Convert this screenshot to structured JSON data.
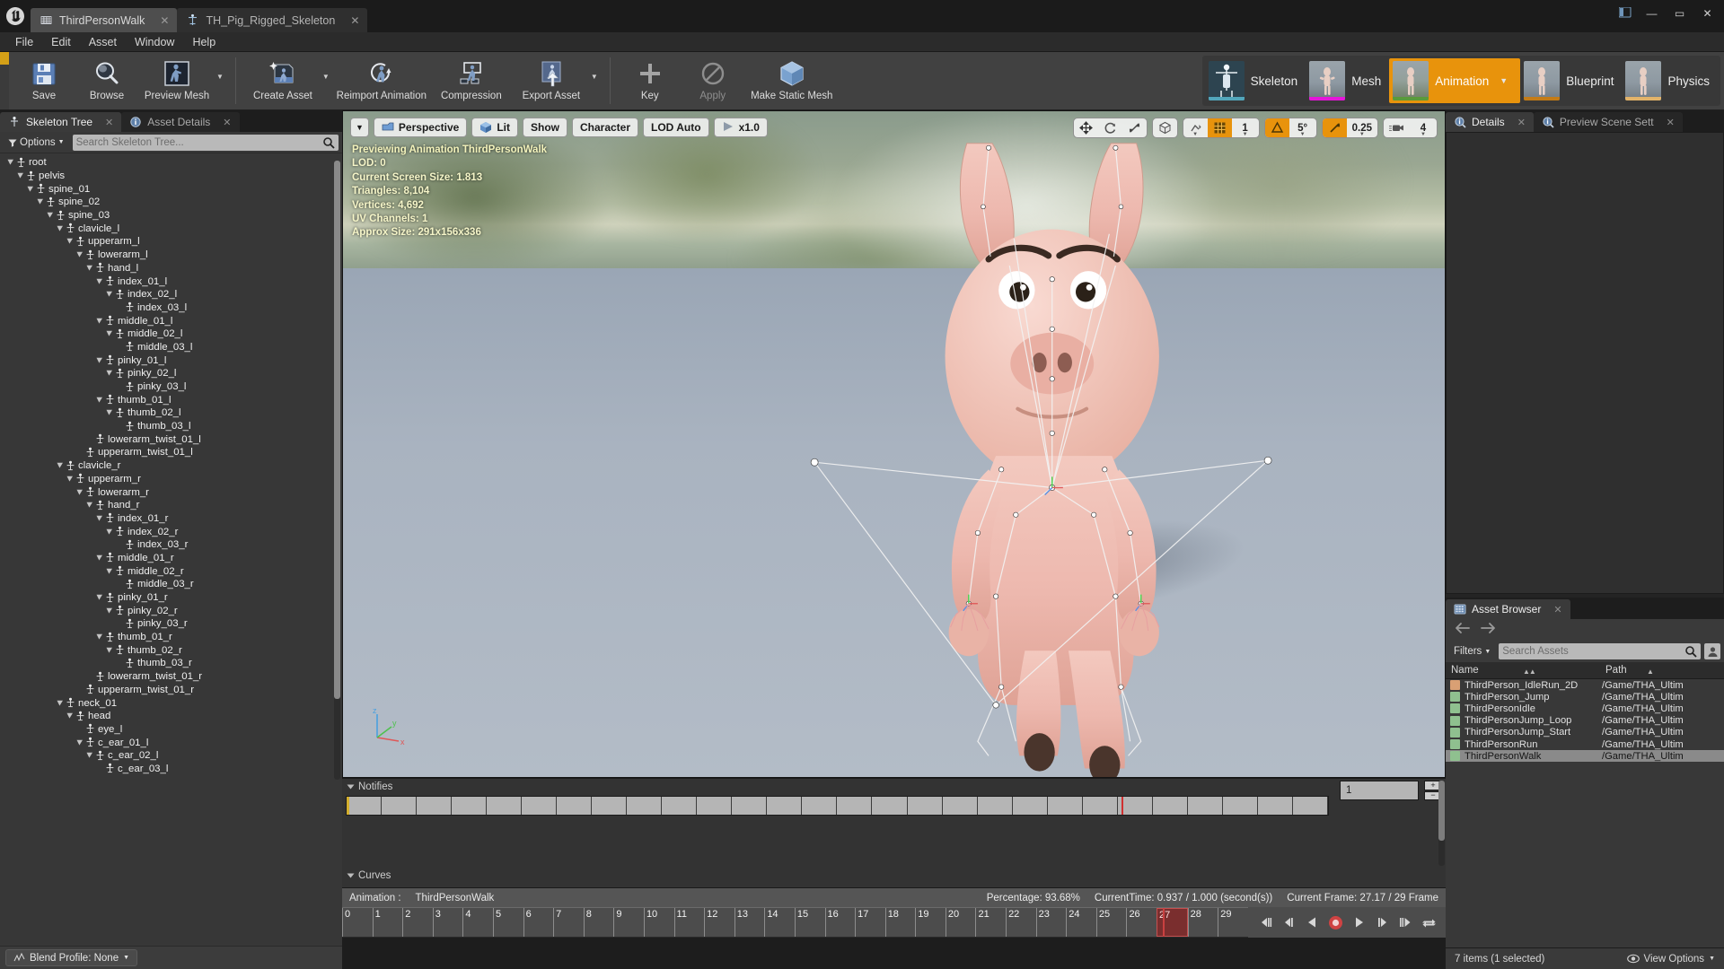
{
  "window": {
    "tabs": [
      {
        "label": "ThirdPersonWalk",
        "icon": "animation-sequence-icon",
        "active": true
      },
      {
        "label": "TH_Pig_Rigged_Skeleton",
        "icon": "skeleton-icon",
        "active": false
      }
    ],
    "controls": {
      "minimize": "—",
      "maximize": "▭",
      "close": "✕"
    }
  },
  "menubar": {
    "items": [
      "File",
      "Edit",
      "Asset",
      "Window",
      "Help"
    ]
  },
  "toolbar": {
    "items": [
      {
        "label": "Save",
        "icon": "save-icon",
        "dropdown": false
      },
      {
        "label": "Browse",
        "icon": "browse-icon",
        "dropdown": false
      },
      {
        "label": "Preview Mesh",
        "icon": "preview-mesh-icon",
        "dropdown": true
      },
      {
        "label": "Create Asset",
        "icon": "create-asset-icon",
        "dropdown": true
      },
      {
        "label": "Reimport Animation",
        "icon": "reimport-animation-icon",
        "dropdown": false
      },
      {
        "label": "Compression",
        "icon": "compression-icon",
        "dropdown": false
      },
      {
        "label": "Export Asset",
        "icon": "export-asset-icon",
        "dropdown": true
      },
      {
        "label": "Key",
        "icon": "key-icon",
        "dropdown": false
      },
      {
        "label": "Apply",
        "icon": "apply-icon",
        "dropdown": false,
        "disabled": true
      },
      {
        "label": "Make Static Mesh",
        "icon": "make-static-mesh-icon",
        "dropdown": false
      }
    ]
  },
  "modes": {
    "items": [
      {
        "label": "Skeleton",
        "accent": "#52a6bb",
        "active": false
      },
      {
        "label": "Mesh",
        "accent": "#e515d9",
        "active": false
      },
      {
        "label": "Animation",
        "accent": "#5a9b3a",
        "active": true,
        "dropdown": true
      },
      {
        "label": "Blueprint",
        "accent": "#c47b16",
        "active": false
      },
      {
        "label": "Physics",
        "accent": "#e2b36a",
        "active": false
      }
    ],
    "active_color": "#e8930c"
  },
  "left_panel": {
    "tabs": [
      {
        "label": "Skeleton Tree",
        "icon": "skeleton-tree-icon",
        "active": true
      },
      {
        "label": "Asset Details",
        "icon": "asset-details-icon",
        "active": false
      }
    ],
    "options_label": "Options",
    "search_placeholder": "Search Skeleton Tree...",
    "blend_profile_label": "Blend Profile: None",
    "tree": [
      {
        "name": "root",
        "depth": 0,
        "expanded": true
      },
      {
        "name": "pelvis",
        "depth": 1,
        "expanded": true
      },
      {
        "name": "spine_01",
        "depth": 2,
        "expanded": true
      },
      {
        "name": "spine_02",
        "depth": 3,
        "expanded": true
      },
      {
        "name": "spine_03",
        "depth": 4,
        "expanded": true
      },
      {
        "name": "clavicle_l",
        "depth": 5,
        "expanded": true
      },
      {
        "name": "upperarm_l",
        "depth": 6,
        "expanded": true
      },
      {
        "name": "lowerarm_l",
        "depth": 7,
        "expanded": true
      },
      {
        "name": "hand_l",
        "depth": 8,
        "expanded": true
      },
      {
        "name": "index_01_l",
        "depth": 9,
        "expanded": true
      },
      {
        "name": "index_02_l",
        "depth": 10,
        "expanded": true
      },
      {
        "name": "index_03_l",
        "depth": 11,
        "expanded": false
      },
      {
        "name": "middle_01_l",
        "depth": 9,
        "expanded": true
      },
      {
        "name": "middle_02_l",
        "depth": 10,
        "expanded": true
      },
      {
        "name": "middle_03_l",
        "depth": 11,
        "expanded": false
      },
      {
        "name": "pinky_01_l",
        "depth": 9,
        "expanded": true
      },
      {
        "name": "pinky_02_l",
        "depth": 10,
        "expanded": true
      },
      {
        "name": "pinky_03_l",
        "depth": 11,
        "expanded": false
      },
      {
        "name": "thumb_01_l",
        "depth": 9,
        "expanded": true
      },
      {
        "name": "thumb_02_l",
        "depth": 10,
        "expanded": true
      },
      {
        "name": "thumb_03_l",
        "depth": 11,
        "expanded": false
      },
      {
        "name": "lowerarm_twist_01_l",
        "depth": 8,
        "expanded": false
      },
      {
        "name": "upperarm_twist_01_l",
        "depth": 7,
        "expanded": false
      },
      {
        "name": "clavicle_r",
        "depth": 5,
        "expanded": true
      },
      {
        "name": "upperarm_r",
        "depth": 6,
        "expanded": true
      },
      {
        "name": "lowerarm_r",
        "depth": 7,
        "expanded": true
      },
      {
        "name": "hand_r",
        "depth": 8,
        "expanded": true
      },
      {
        "name": "index_01_r",
        "depth": 9,
        "expanded": true
      },
      {
        "name": "index_02_r",
        "depth": 10,
        "expanded": true
      },
      {
        "name": "index_03_r",
        "depth": 11,
        "expanded": false
      },
      {
        "name": "middle_01_r",
        "depth": 9,
        "expanded": true
      },
      {
        "name": "middle_02_r",
        "depth": 10,
        "expanded": true
      },
      {
        "name": "middle_03_r",
        "depth": 11,
        "expanded": false
      },
      {
        "name": "pinky_01_r",
        "depth": 9,
        "expanded": true
      },
      {
        "name": "pinky_02_r",
        "depth": 10,
        "expanded": true
      },
      {
        "name": "pinky_03_r",
        "depth": 11,
        "expanded": false
      },
      {
        "name": "thumb_01_r",
        "depth": 9,
        "expanded": true
      },
      {
        "name": "thumb_02_r",
        "depth": 10,
        "expanded": true
      },
      {
        "name": "thumb_03_r",
        "depth": 11,
        "expanded": false
      },
      {
        "name": "lowerarm_twist_01_r",
        "depth": 8,
        "expanded": false
      },
      {
        "name": "upperarm_twist_01_r",
        "depth": 7,
        "expanded": false
      },
      {
        "name": "neck_01",
        "depth": 5,
        "expanded": true
      },
      {
        "name": "head",
        "depth": 6,
        "expanded": true
      },
      {
        "name": "eye_l",
        "depth": 7,
        "expanded": false
      },
      {
        "name": "c_ear_01_l",
        "depth": 7,
        "expanded": true
      },
      {
        "name": "c_ear_02_l",
        "depth": 8,
        "expanded": true
      },
      {
        "name": "c_ear_03_l",
        "depth": 9,
        "expanded": false
      }
    ]
  },
  "viewport": {
    "toolbar": [
      {
        "label": "Perspective",
        "icon": "camera-icon"
      },
      {
        "label": "Lit",
        "icon": "lighting-cube-icon"
      },
      {
        "label": "Show",
        "icon": ""
      },
      {
        "label": "Character",
        "icon": ""
      },
      {
        "label": "LOD Auto",
        "icon": ""
      },
      {
        "label": "x1.0",
        "icon": "play-speed-icon"
      }
    ],
    "dropdown_caret": "▾",
    "stats": {
      "previewing": "Previewing Animation ThirdPersonWalk",
      "lod": "LOD: 0",
      "screen_size": "Current Screen Size: 1.813",
      "triangles": "Triangles: 8,104",
      "vertices": "Vertices: 4,692",
      "uv_channels": "UV Channels: 1",
      "approx_size": "Approx Size: 291x156x336"
    },
    "transform_tools": {
      "translate_icon": "move-tool-icon",
      "rotate_icon": "rotate-tool-icon",
      "scale_icon": "scale-tool-icon",
      "coord_icon": "world-space-icon",
      "surface_snap_icon": "surface-snap-icon",
      "grid_snap_icon": "grid-snap-icon",
      "grid_snap_value": "1",
      "angle_snap_icon": "angle-snap-icon",
      "angle_snap_value": "5°",
      "scale_snap_icon": "scale-snap-icon",
      "scale_snap_value": "0.25",
      "camera_speed_icon": "camera-speed-icon",
      "camera_speed_value": "4"
    },
    "axis": {
      "z": "z",
      "y": "y",
      "x": "x"
    }
  },
  "notifies": {
    "title": "Notifies",
    "curves_title": "Curves",
    "frame_value": "1",
    "plus": "+",
    "minus": "−",
    "track_cells": 28,
    "playhead_pct": 79
  },
  "timeline": {
    "animation_label": "Animation :",
    "animation_name": "ThirdPersonWalk",
    "percentage": "Percentage:  93.68%",
    "current_time": "CurrentTime:  0.937 / 1.000 (second(s))",
    "current_frame": "Current Frame:  27.17 / 29 Frame",
    "frames": [
      "0",
      "1",
      "2",
      "3",
      "4",
      "5",
      "6",
      "7",
      "8",
      "9",
      "10",
      "11",
      "12",
      "13",
      "14",
      "15",
      "16",
      "17",
      "18",
      "19",
      "20",
      "21",
      "22",
      "23",
      "24",
      "25",
      "26",
      "27",
      "28",
      "29"
    ],
    "current_frame_index": 27,
    "transport": [
      {
        "name": "skip-to-start-button",
        "glyph": "start"
      },
      {
        "name": "step-back-button",
        "glyph": "stepback"
      },
      {
        "name": "play-reverse-button",
        "glyph": "playrev"
      },
      {
        "name": "record-button",
        "glyph": "record"
      },
      {
        "name": "play-forward-button",
        "glyph": "play"
      },
      {
        "name": "step-forward-button",
        "glyph": "stepfwd"
      },
      {
        "name": "skip-to-end-button",
        "glyph": "end"
      },
      {
        "name": "loop-button",
        "glyph": "loop"
      }
    ]
  },
  "right_panel": {
    "tabs": [
      {
        "label": "Details",
        "icon": "details-icon",
        "active": true
      },
      {
        "label": "Preview Scene Sett",
        "icon": "preview-scene-icon",
        "active": false
      }
    ],
    "asset_browser": {
      "tab_label": "Asset Browser",
      "tab_icon": "asset-browser-icon",
      "back_icon": "arrow-left-icon",
      "forward_icon": "arrow-right-icon",
      "filters_label": "Filters",
      "search_placeholder": "Search Assets",
      "columns": [
        "Name",
        "Path"
      ],
      "rows": [
        {
          "name": "ThirdPerson_IdleRun_2D",
          "path": "/Game/THA_Ultim",
          "color": "#d9a074",
          "selected": false
        },
        {
          "name": "ThirdPerson_Jump",
          "path": "/Game/THA_Ultim",
          "color": "#8fc08f",
          "selected": false
        },
        {
          "name": "ThirdPersonIdle",
          "path": "/Game/THA_Ultim",
          "color": "#8fc08f",
          "selected": false
        },
        {
          "name": "ThirdPersonJump_Loop",
          "path": "/Game/THA_Ultim",
          "color": "#8fc08f",
          "selected": false
        },
        {
          "name": "ThirdPersonJump_Start",
          "path": "/Game/THA_Ultim",
          "color": "#8fc08f",
          "selected": false
        },
        {
          "name": "ThirdPersonRun",
          "path": "/Game/THA_Ultim",
          "color": "#8fc08f",
          "selected": false
        },
        {
          "name": "ThirdPersonWalk",
          "path": "/Game/THA_Ultim",
          "color": "#8fc08f",
          "selected": true
        }
      ],
      "status": "7 items (1 selected)",
      "view_options": "View Options"
    }
  }
}
